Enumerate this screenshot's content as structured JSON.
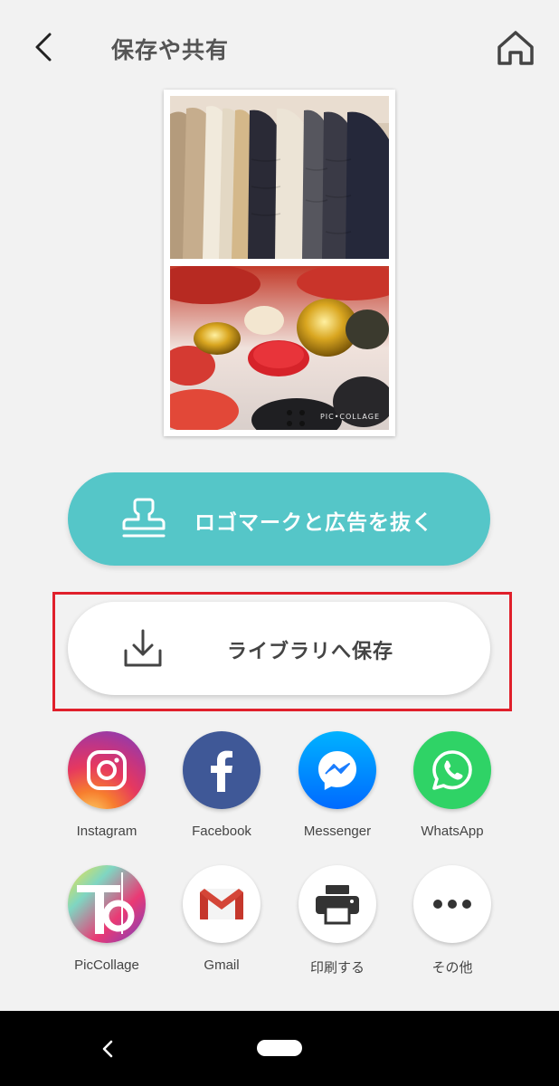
{
  "header": {
    "title": "保存や共有",
    "back_icon": "chevron-left-icon",
    "home_icon": "home-icon"
  },
  "preview": {
    "watermark": "PIC•COLLAGE"
  },
  "actions": {
    "remove_ads_label": "ロゴマークと広告を抜く",
    "remove_ads_icon": "stamp-icon",
    "save_label": "ライブラリへ保存",
    "save_icon": "download-icon"
  },
  "share": {
    "items": [
      {
        "label": "Instagram",
        "icon": "instagram-icon"
      },
      {
        "label": "Facebook",
        "icon": "facebook-icon"
      },
      {
        "label": "Messenger",
        "icon": "messenger-icon"
      },
      {
        "label": "WhatsApp",
        "icon": "whatsapp-icon"
      },
      {
        "label": "PicCollage",
        "icon": "piccollage-icon"
      },
      {
        "label": "Gmail",
        "icon": "gmail-icon"
      },
      {
        "label": "印刷する",
        "icon": "printer-icon"
      },
      {
        "label": "その他",
        "icon": "more-icon"
      }
    ]
  },
  "colors": {
    "accent": "#55c6c8",
    "highlight": "#e0202b",
    "background": "#f2f2f2"
  }
}
